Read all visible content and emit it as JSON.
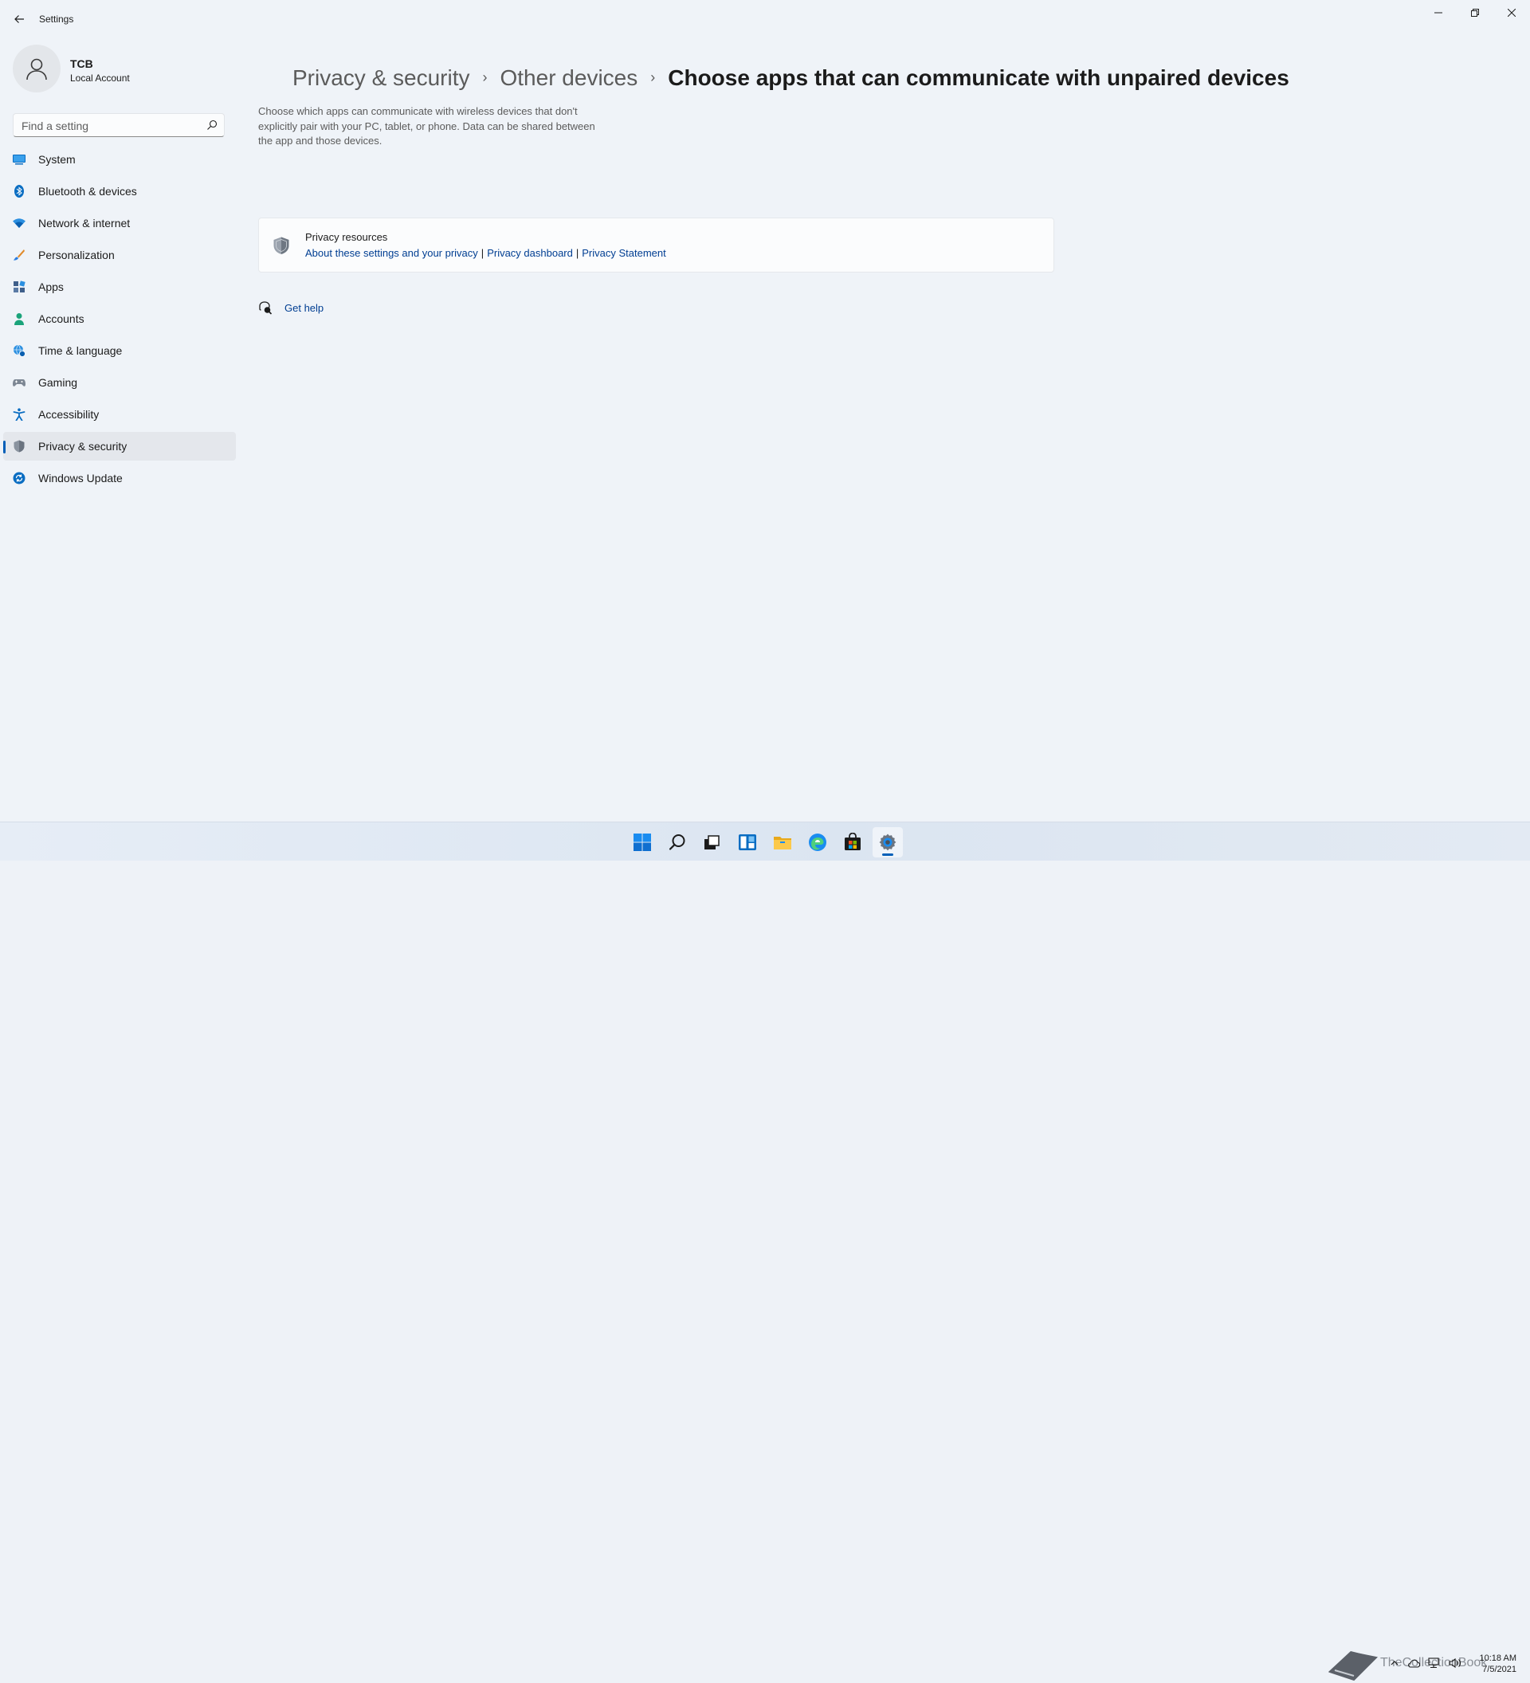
{
  "window": {
    "title": "Settings"
  },
  "profile": {
    "name": "TCB",
    "account_type": "Local Account"
  },
  "search": {
    "placeholder": "Find a setting"
  },
  "sidebar": {
    "items": [
      {
        "label": "System",
        "icon": "monitor-icon"
      },
      {
        "label": "Bluetooth & devices",
        "icon": "bluetooth-icon"
      },
      {
        "label": "Network & internet",
        "icon": "wifi-icon"
      },
      {
        "label": "Personalization",
        "icon": "brush-icon"
      },
      {
        "label": "Apps",
        "icon": "apps-icon"
      },
      {
        "label": "Accounts",
        "icon": "person-icon"
      },
      {
        "label": "Time & language",
        "icon": "globe-clock-icon"
      },
      {
        "label": "Gaming",
        "icon": "gamepad-icon"
      },
      {
        "label": "Accessibility",
        "icon": "accessibility-icon"
      },
      {
        "label": "Privacy & security",
        "icon": "shield-icon",
        "active": true
      },
      {
        "label": "Windows Update",
        "icon": "update-icon"
      }
    ]
  },
  "breadcrumb": {
    "items": [
      "Privacy & security",
      "Other devices"
    ],
    "current": "Choose apps that can communicate with unpaired devices",
    "separator": "›"
  },
  "description": "Choose which apps can communicate with wireless devices that don't explicitly pair with your PC, tablet, or phone. Data can be shared between the app and those devices.",
  "privacy_resources": {
    "title": "Privacy resources",
    "links": [
      "About these settings and your privacy",
      "Privacy dashboard",
      "Privacy Statement"
    ],
    "separator": "|"
  },
  "get_help": {
    "label": "Get help"
  },
  "taskbar": {
    "apps": [
      "start-icon",
      "search-icon",
      "task-view-icon",
      "widgets-icon",
      "file-explorer-icon",
      "edge-icon",
      "store-icon",
      "settings-icon"
    ],
    "watermark": "TheCollectionBook",
    "clock_time": "10:18 AM",
    "clock_date": "7/5/2021"
  },
  "colors": {
    "accent": "#005fb8",
    "link": "#003e92",
    "background": "#eff3f8"
  }
}
